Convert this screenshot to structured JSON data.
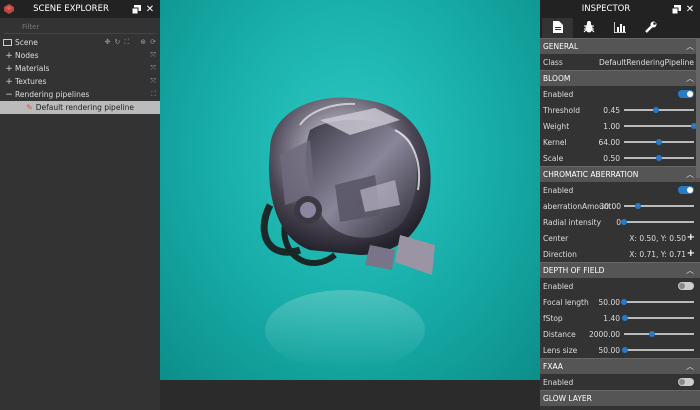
{
  "explorer": {
    "title": "SCENE EXPLORER",
    "filter_placeholder": "Filter",
    "scene_label": "Scene",
    "items": [
      {
        "label": "Nodes",
        "toggle": "+"
      },
      {
        "label": "Materials",
        "toggle": "+"
      },
      {
        "label": "Textures",
        "toggle": "+"
      },
      {
        "label": "Rendering pipelines",
        "toggle": "−"
      }
    ],
    "selected_item": "Default rendering pipeline"
  },
  "inspector": {
    "title": "INSPECTOR",
    "tabs": [
      "document-icon",
      "bug-icon",
      "chart-icon",
      "wrench-icon"
    ],
    "general": {
      "header": "GENERAL",
      "class_label": "Class",
      "class_value": "DefaultRenderingPipeline"
    },
    "bloom": {
      "header": "BLOOM",
      "enabled_label": "Enabled",
      "enabled": true,
      "threshold_label": "Threshold",
      "threshold_value": "0.45",
      "threshold_level": 0.45,
      "weight_label": "Weight",
      "weight_value": "1.00",
      "weight_level": 1.0,
      "kernel_label": "Kernel",
      "kernel_value": "64.00",
      "kernel_level": 0.5,
      "scale_label": "Scale",
      "scale_value": "0.50",
      "scale_level": 0.5
    },
    "chromatic": {
      "header": "CHROMATIC ABERRATION",
      "enabled_label": "Enabled",
      "enabled": true,
      "amount_label": "aberrationAmount",
      "amount_value": "30.00",
      "amount_level": 0.2,
      "radial_label": "Radial intensity",
      "radial_value": "0",
      "radial_level": 0.0,
      "center_label": "Center",
      "center_value": "X: 0.50, Y: 0.50",
      "direction_label": "Direction",
      "direction_value": "X: 0.71, Y: 0.71"
    },
    "dof": {
      "header": "DEPTH OF FIELD",
      "enabled_label": "Enabled",
      "enabled": false,
      "focal_label": "Focal length",
      "focal_value": "50.00",
      "focal_level": 0.0,
      "fstop_label": "fStop",
      "fstop_value": "1.40",
      "fstop_level": 0.02,
      "distance_label": "Distance",
      "distance_value": "2000.00",
      "distance_level": 0.4,
      "lens_label": "Lens size",
      "lens_value": "50.00",
      "lens_level": 0.02
    },
    "fxaa": {
      "header": "FXAA",
      "enabled_label": "Enabled",
      "enabled": false
    },
    "glow": {
      "header": "GLOW LAYER"
    }
  },
  "colors": {
    "accent": "#2a7bc7",
    "viewport_bg": "#17aba6",
    "panel_bg": "#333333",
    "header_bg": "#222222"
  }
}
